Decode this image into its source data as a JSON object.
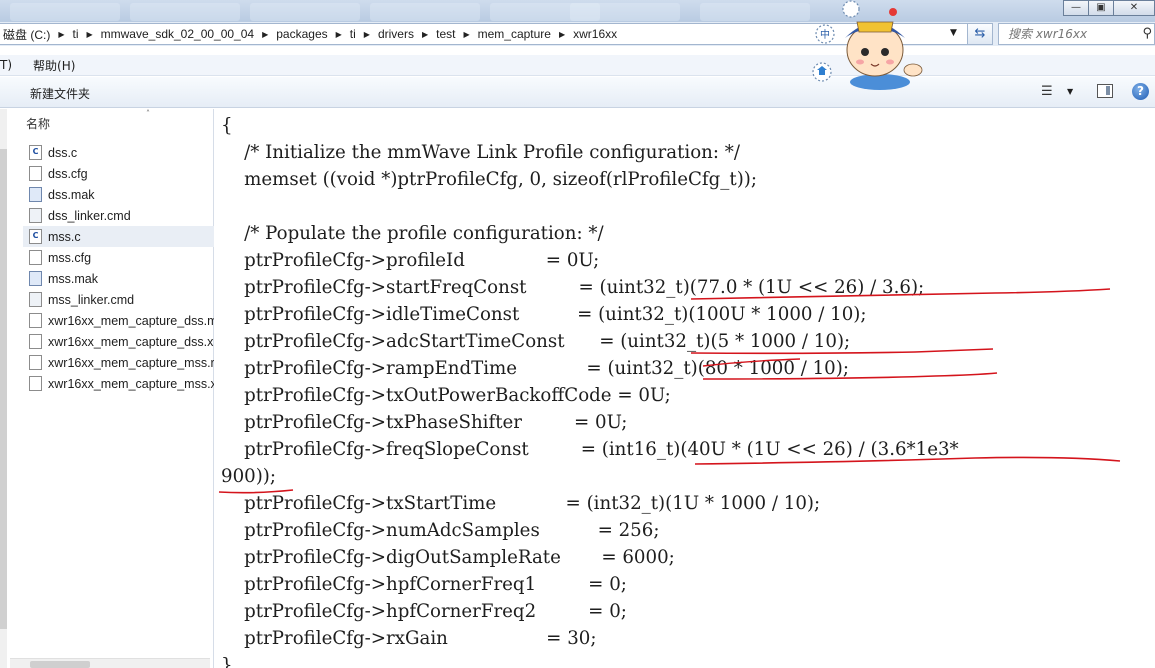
{
  "address": {
    "crumbs": [
      "磁盘 (C:)",
      "ti",
      "mmwave_sdk_02_00_00_04",
      "packages",
      "ti",
      "drivers",
      "test",
      "mem_capture",
      "xwr16xx"
    ],
    "search_placeholder": "搜索 xwr16xx"
  },
  "menu": {
    "item1": "T)",
    "item2": "帮助(H)"
  },
  "toolbar": {
    "new_folder": "新建文件夹"
  },
  "files": {
    "column_header": "名称",
    "items": [
      {
        "name": "dss.c",
        "type": "c"
      },
      {
        "name": "dss.cfg",
        "type": "doc"
      },
      {
        "name": "dss.mak",
        "type": "mak"
      },
      {
        "name": "dss_linker.cmd",
        "type": "cmd"
      },
      {
        "name": "mss.c",
        "type": "c"
      },
      {
        "name": "mss.cfg",
        "type": "doc"
      },
      {
        "name": "mss.mak",
        "type": "mak"
      },
      {
        "name": "mss_linker.cmd",
        "type": "cmd"
      },
      {
        "name": "xwr16xx_mem_capture_dss.m",
        "type": "doc"
      },
      {
        "name": "xwr16xx_mem_capture_dss.x",
        "type": "doc"
      },
      {
        "name": "xwr16xx_mem_capture_mss.r",
        "type": "doc"
      },
      {
        "name": "xwr16xx_mem_capture_mss.x",
        "type": "doc"
      }
    ],
    "selected": "mss.c"
  },
  "code": {
    "lines": [
      "{",
      "    /* Initialize the mmWave Link Profile configuration: */",
      "    memset ((void *)ptrProfileCfg, 0, sizeof(rlProfileCfg_t));",
      "",
      "    /* Populate the profile configuration: */",
      "    ptrProfileCfg->profileId              = 0U;",
      "    ptrProfileCfg->startFreqConst         = (uint32_t)(77.0 * (1U << 26) / 3.6);",
      "    ptrProfileCfg->idleTimeConst          = (uint32_t)(100U * 1000 / 10);",
      "    ptrProfileCfg->adcStartTimeConst      = (uint32_t)(5 * 1000 / 10);",
      "    ptrProfileCfg->rampEndTime            = (uint32_t)(80 * 1000 / 10);",
      "    ptrProfileCfg->txOutPowerBackoffCode = 0U;",
      "    ptrProfileCfg->txPhaseShifter         = 0U;",
      "    ptrProfileCfg->freqSlopeConst         = (int16_t)(40U * (1U << 26) / (3.6*1e3*",
      "900));",
      "    ptrProfileCfg->txStartTime            = (int32_t)(1U * 1000 / 10);",
      "    ptrProfileCfg->numAdcSamples          = 256;",
      "    ptrProfileCfg->digOutSampleRate       = 6000;",
      "    ptrProfileCfg->hpfCornerFreq1         = 0;",
      "    ptrProfileCfg->hpfCornerFreq2         = 0;",
      "    ptrProfileCfg->rxGain                 = 30;",
      "}"
    ]
  },
  "colors": {
    "annotation_red": "#d4141c"
  }
}
